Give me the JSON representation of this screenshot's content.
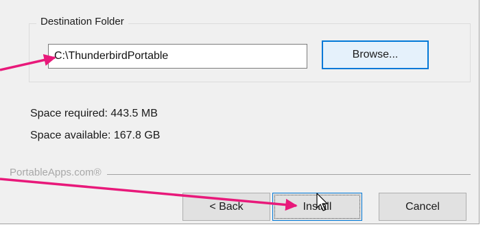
{
  "destination": {
    "group_label": "Destination Folder",
    "path_value": "C:\\ThunderbirdPortable",
    "browse_label": "Browse..."
  },
  "space": {
    "required": "Space required: 443.5 MB",
    "available": "Space available: 167.8 GB"
  },
  "branding": {
    "text": "PortableApps.com®"
  },
  "buttons": {
    "back_label": "< Back",
    "install_label": "Install",
    "cancel_label": "Cancel"
  },
  "annotations": {
    "arrow_color": "#e8197a"
  }
}
